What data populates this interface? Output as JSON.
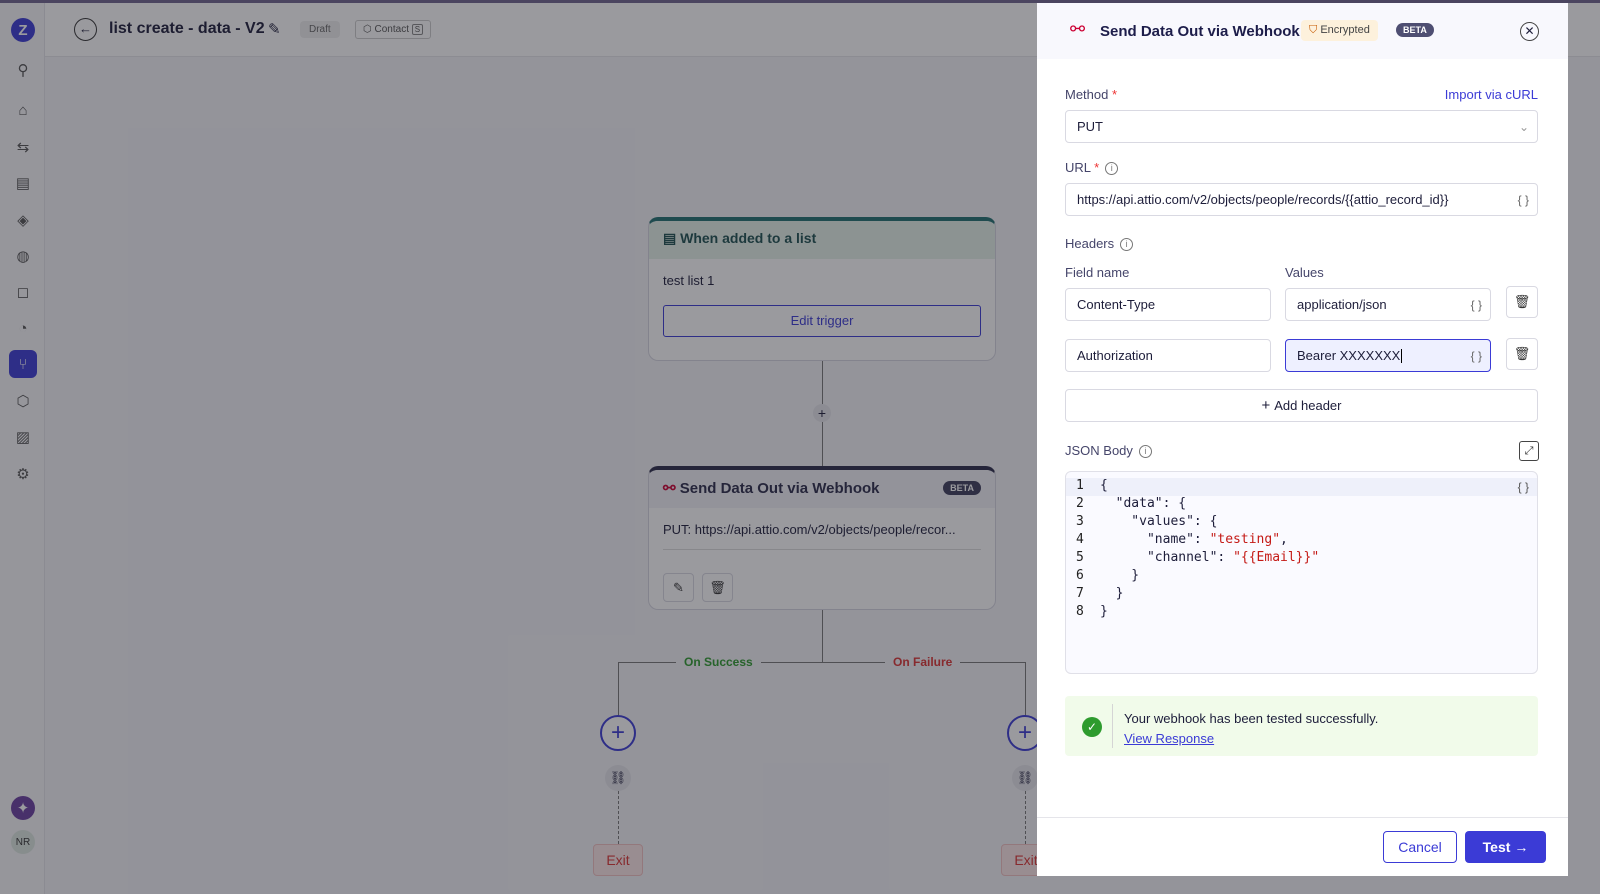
{
  "header": {
    "title": "list create - data - V2",
    "status": "Draft",
    "object_label": "Contact",
    "object_key": "S"
  },
  "sidebar": {
    "logo": "Z",
    "user_initials": "NR",
    "icons": [
      "rocket-icon",
      "home-icon",
      "campaigns-icon",
      "contacts-icon",
      "segments-icon",
      "broadcast-icon",
      "messages-icon",
      "conversations-icon",
      "journeys-icon",
      "objects-icon",
      "reports-icon",
      "settings-icon"
    ]
  },
  "canvas": {
    "trigger": {
      "title": "When added to a list",
      "list": "test list 1",
      "button": "Edit trigger"
    },
    "webhook": {
      "title": "Send Data Out via Webhook",
      "badge": "BETA",
      "summary": "PUT: https://api.attio.com/v2/objects/people/recor..."
    },
    "branch_success": "On Success",
    "branch_failure": "On Failure",
    "exit": "Exit"
  },
  "panel": {
    "title": "Send Data Out via Webhook",
    "encrypted": "Encrypted",
    "badge": "BETA",
    "method_label": "Method",
    "required": "*",
    "import_link": "Import via cURL",
    "method_value": "PUT",
    "url_label": "URL",
    "url_value": "https://api.attio.com/v2/objects/people/records/{{attio_record_id}}",
    "headers_label": "Headers",
    "field_name_label": "Field name",
    "values_label": "Values",
    "headers": [
      {
        "name": "Content-Type",
        "value": "application/json"
      },
      {
        "name": "Authorization",
        "value": "Bearer  XXXXXXX"
      }
    ],
    "add_header": "Add header",
    "braces": "{ }",
    "json_label": "JSON Body",
    "json_lines": [
      {
        "n": "1",
        "k": "{",
        "v": ""
      },
      {
        "n": "2",
        "k": "  \"data\": {",
        "v": ""
      },
      {
        "n": "3",
        "k": "    \"values\": {",
        "v": ""
      },
      {
        "n": "4",
        "k": "      \"name\": ",
        "v": "\"testing\"",
        "t": ","
      },
      {
        "n": "5",
        "k": "      \"channel\": ",
        "v": "\"{{Email}}\"",
        "t": ""
      },
      {
        "n": "6",
        "k": "    }",
        "v": ""
      },
      {
        "n": "7",
        "k": "  }",
        "v": ""
      },
      {
        "n": "8",
        "k": "}",
        "v": ""
      }
    ],
    "success_text": "Your webhook has been tested successfully.",
    "view_response": "View Response",
    "cancel": "Cancel",
    "test": "Test"
  },
  "colors": {
    "accent": "#3b3bd6",
    "success": "#2e9b2e",
    "failure": "#d33",
    "code_string": "#c41a16"
  }
}
